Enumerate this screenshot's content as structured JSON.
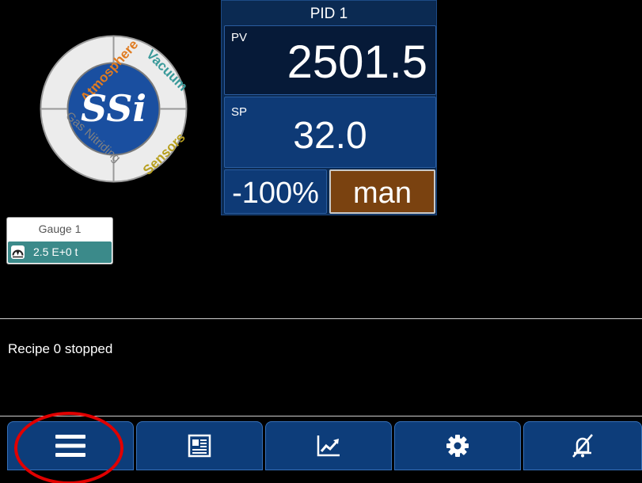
{
  "logo": {
    "center_text": "SSi",
    "ring_words": [
      "Atmosphere",
      "Vacuum",
      "Sensors",
      "Gas Nitriding"
    ],
    "colors": {
      "atmosphere": "#e07b20",
      "vacuum": "#3a9a9a",
      "sensors": "#b8a020",
      "nitriding": "#808080",
      "center": "#1a4fa0"
    }
  },
  "pid": {
    "title": "PID 1",
    "pv_label": "PV",
    "pv_value": "2501.5",
    "sp_label": "SP",
    "sp_value": "32.0",
    "output": "-100%",
    "mode_button": "man"
  },
  "gauge": {
    "title": "Gauge 1",
    "icon": "gauge-icon",
    "value": "2.5 E+0 t"
  },
  "status": {
    "message": "Recipe 0 stopped"
  },
  "navbar": {
    "items": [
      {
        "icon": "menu-icon"
      },
      {
        "icon": "newspaper-icon"
      },
      {
        "icon": "trend-chart-icon"
      },
      {
        "icon": "gear-icon"
      },
      {
        "icon": "alarm-silenced-icon"
      }
    ]
  },
  "colors": {
    "panel_bg": "#0b2a52",
    "pv_bg": "#061a38",
    "sp_bg": "#0e3a76",
    "man_button": "#7a4210",
    "gauge_value_bg": "#3b8a8a",
    "highlight_ring": "#e00000"
  }
}
